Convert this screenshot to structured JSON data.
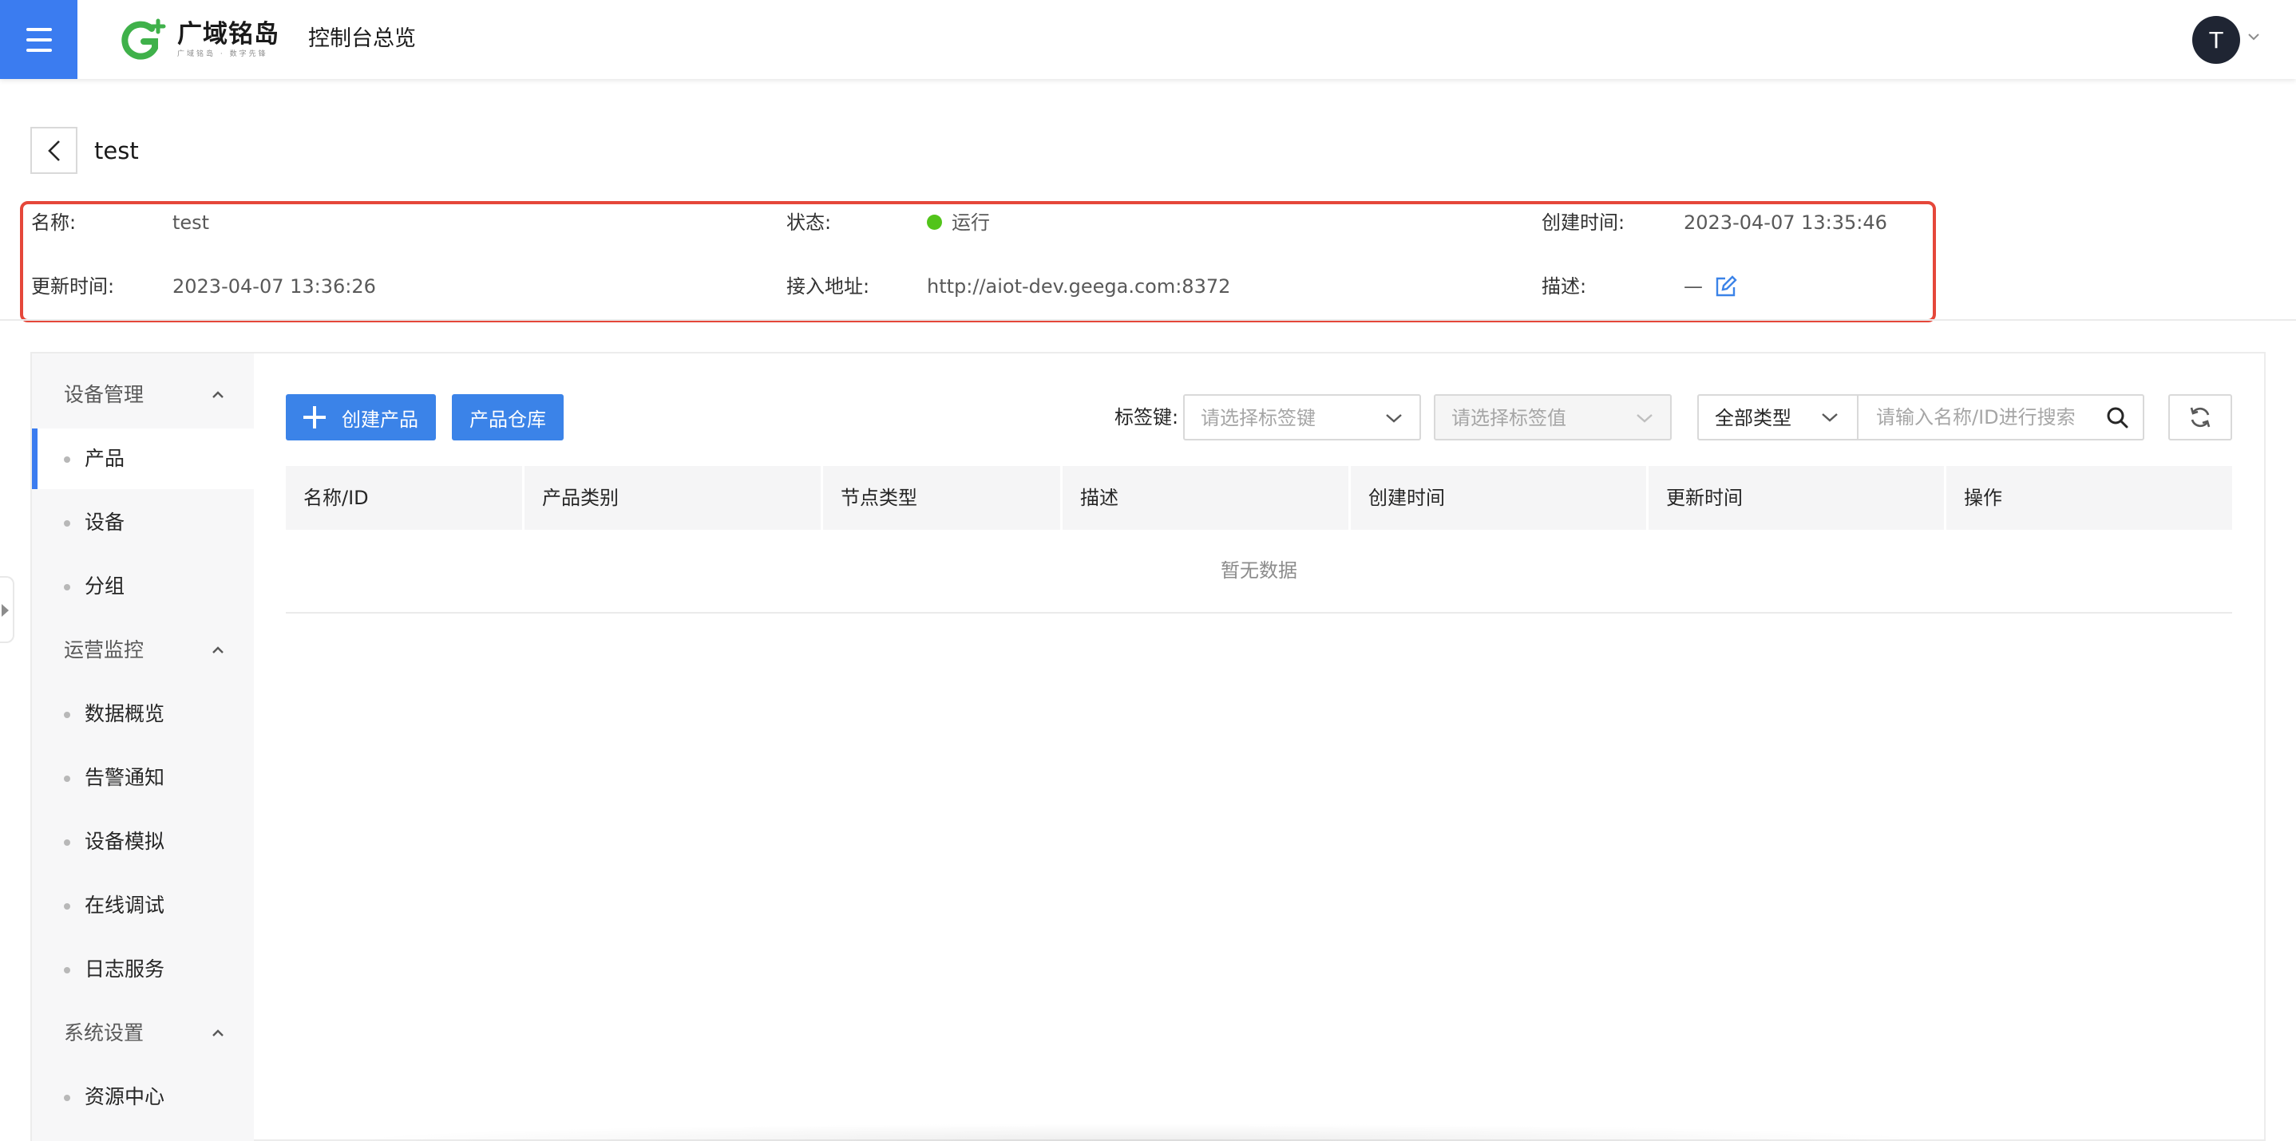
{
  "header": {
    "logo_title": "广域铭岛",
    "logo_sub": "广域铭岛 · 数字先锋",
    "console_title": "控制台总览",
    "user_initial": "T",
    "brand_color": "#3b7cf0"
  },
  "page": {
    "title": "test"
  },
  "info": {
    "name_label": "名称:",
    "name_value": "test",
    "status_label": "状态:",
    "status_value": "运行",
    "status_color": "#52c41a",
    "created_label": "创建时间:",
    "created_value": "2023-04-07 13:35:46",
    "updated_label": "更新时间:",
    "updated_value": "2023-04-07 13:36:26",
    "address_label": "接入地址:",
    "address_value": "http://aiot-dev.geega.com:8372",
    "desc_label": "描述:",
    "desc_value": "—"
  },
  "sidebar": {
    "groups": [
      {
        "title": "设备管理",
        "items": [
          "产品",
          "设备",
          "分组"
        ]
      },
      {
        "title": "运营监控",
        "items": [
          "数据概览",
          "告警通知",
          "设备模拟",
          "在线调试",
          "日志服务"
        ]
      },
      {
        "title": "系统设置",
        "items": [
          "资源中心"
        ]
      }
    ],
    "active_item": "产品"
  },
  "toolbar": {
    "create_label": "创建产品",
    "warehouse_label": "产品仓库",
    "tag_key_label": "标签键:",
    "tag_key_placeholder": "请选择标签键",
    "tag_value_placeholder": "请选择标签值",
    "type_select_value": "全部类型",
    "search_placeholder": "请输入名称/ID进行搜索"
  },
  "table": {
    "columns": [
      "名称/ID",
      "产品类别",
      "节点类型",
      "描述",
      "创建时间",
      "更新时间",
      "操作"
    ],
    "rows": [],
    "empty_text": "暂无数据"
  }
}
